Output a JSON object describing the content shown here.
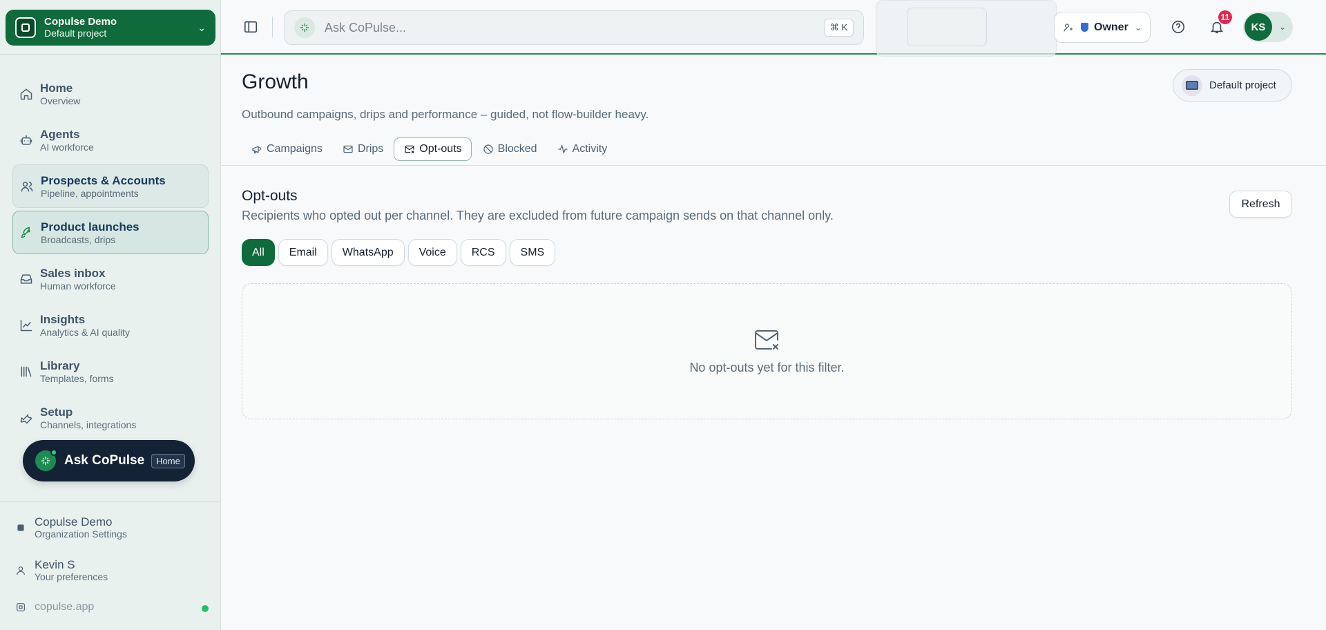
{
  "sidebar": {
    "org": {
      "name": "Copulse Demo",
      "project": "Default project"
    },
    "items": [
      {
        "label": "Home",
        "sub": "Overview",
        "icon": "home-icon"
      },
      {
        "label": "Agents",
        "sub": "AI workforce",
        "icon": "robot-icon"
      },
      {
        "label": "Prospects & Accounts",
        "sub": "Pipeline, appointments",
        "icon": "users-icon"
      },
      {
        "label": "Product launches",
        "sub": "Broadcasts, drips",
        "icon": "rocket-icon"
      },
      {
        "label": "Sales inbox",
        "sub": "Human workforce",
        "icon": "inbox-icon"
      },
      {
        "label": "Insights",
        "sub": "Analytics & AI quality",
        "icon": "chart-line-icon"
      },
      {
        "label": "Library",
        "sub": "Templates, forms",
        "icon": "library-icon"
      },
      {
        "label": "Setup",
        "sub": "Channels, integrations",
        "icon": "wrench-icon"
      }
    ],
    "ask": {
      "label": "Ask CoPulse",
      "badge": "Home"
    },
    "footer": {
      "org_title": "Copulse Demo",
      "org_sub": "Organization Settings",
      "user_title": "Kevin S",
      "user_sub": "Your preferences",
      "domain": "copulse.app"
    }
  },
  "topbar": {
    "search_placeholder": "Ask CoPulse...",
    "shortcut": "⌘ K",
    "role": "Owner",
    "notifications": "11",
    "avatar_initials": "KS"
  },
  "page": {
    "title": "Growth",
    "description": "Outbound campaigns, drips and performance – guided, not flow-builder heavy.",
    "project_chip": "Default project",
    "tabs": [
      "Campaigns",
      "Drips",
      "Opt-outs",
      "Blocked",
      "Activity"
    ],
    "active_tab": "Opt-outs"
  },
  "section": {
    "title": "Opt-outs",
    "description": "Recipients who opted out per channel. They are excluded from future campaign sends on that channel only.",
    "refresh": "Refresh",
    "filters": [
      "All",
      "Email",
      "WhatsApp",
      "Voice",
      "RCS",
      "SMS"
    ],
    "active_filter": "All",
    "empty_text": "No opt-outs yet for this filter."
  },
  "colors": {
    "brand": "#0f6b3b",
    "accent": "#1f8a52",
    "badge": "#e1294f"
  }
}
